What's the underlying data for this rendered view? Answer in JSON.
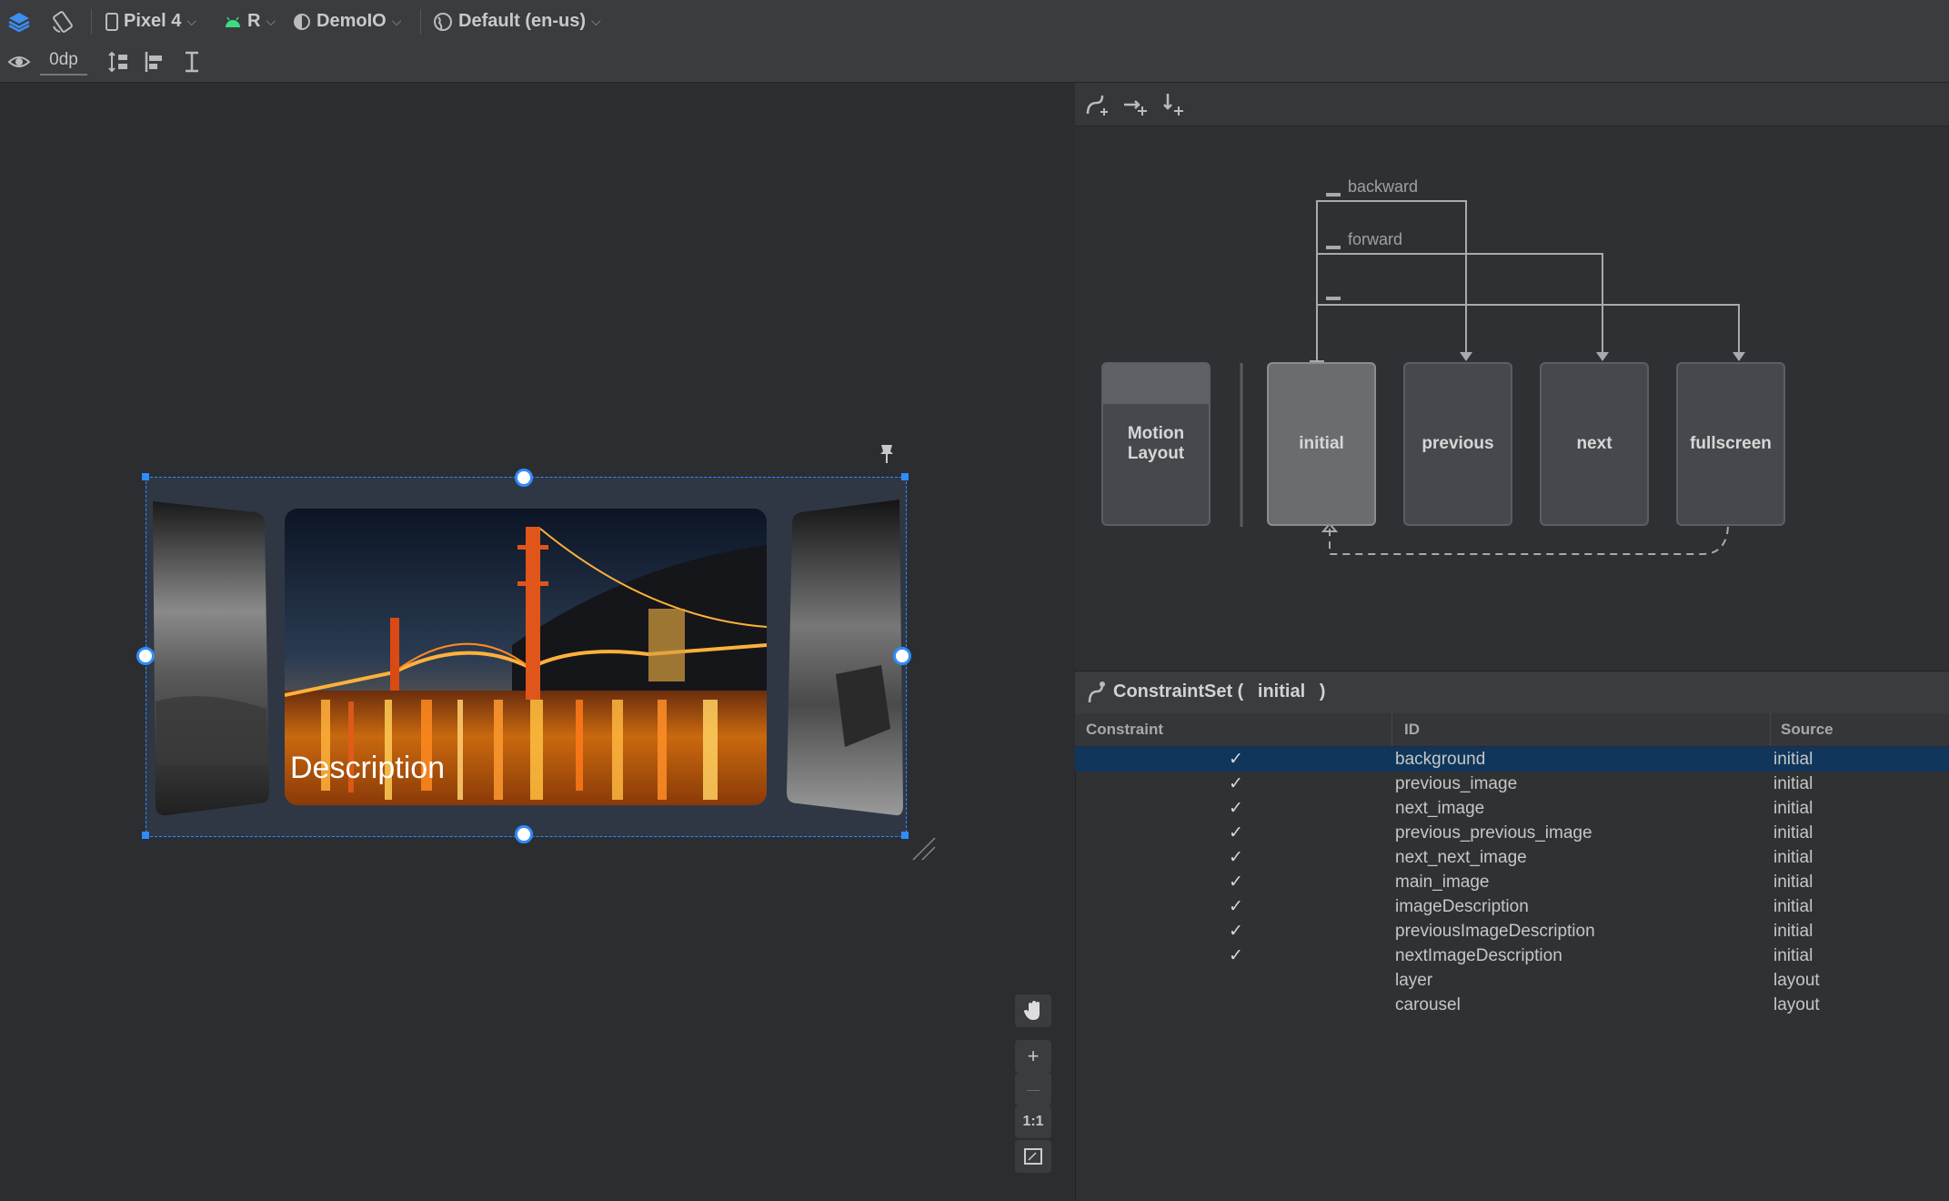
{
  "toolbar": {
    "device_label": "Pixel 4",
    "api_label": "R",
    "theme_label": "DemoIO",
    "locale_label": "Default (en-us)",
    "margin_value": "0dp"
  },
  "colors": {
    "selection_blue": "#2f8cff",
    "selected_row": "#10365b",
    "android_green": "#3ddc84"
  },
  "design": {
    "description_text": "Description"
  },
  "motion": {
    "transitions": [
      {
        "label": "backward"
      },
      {
        "label": "forward"
      }
    ],
    "states": {
      "motion_layout": "Motion Layout",
      "initial": "initial",
      "previous": "previous",
      "next": "next",
      "fullscreen": "fullscreen"
    }
  },
  "constraint_set": {
    "title_prefix": "ConstraintSet (",
    "name": "initial",
    "title_suffix": ")",
    "columns": {
      "constraint": "Constraint",
      "id": "ID",
      "source": "Source"
    },
    "rows": [
      {
        "checked": "✓",
        "id": "background",
        "source": "initial"
      },
      {
        "checked": "✓",
        "id": "previous_image",
        "source": "initial"
      },
      {
        "checked": "✓",
        "id": "next_image",
        "source": "initial"
      },
      {
        "checked": "✓",
        "id": "previous_previous_image",
        "source": "initial"
      },
      {
        "checked": "✓",
        "id": "next_next_image",
        "source": "initial"
      },
      {
        "checked": "✓",
        "id": "main_image",
        "source": "initial"
      },
      {
        "checked": "✓",
        "id": "imageDescription",
        "source": "initial"
      },
      {
        "checked": "✓",
        "id": "previousImageDescription",
        "source": "initial"
      },
      {
        "checked": "✓",
        "id": "nextImageDescription",
        "source": "initial"
      },
      {
        "checked": "",
        "id": "layer",
        "source": "layout"
      },
      {
        "checked": "",
        "id": "carousel",
        "source": "layout"
      }
    ]
  },
  "zoom": {
    "plus": "+",
    "minus": "—",
    "one_to_one": "1:1"
  },
  "icons": [
    "layers-icon",
    "orientation-icon",
    "phone-icon",
    "android-icon",
    "theme-icon",
    "globe-icon",
    "eye-icon",
    "pack-vertical-icon",
    "align-left-icon",
    "baseline-icon",
    "pin-icon",
    "create-transition-icon",
    "create-onclick-icon",
    "create-onswipe-icon",
    "constraintset-icon",
    "hand-icon",
    "fit-screen-icon"
  ]
}
